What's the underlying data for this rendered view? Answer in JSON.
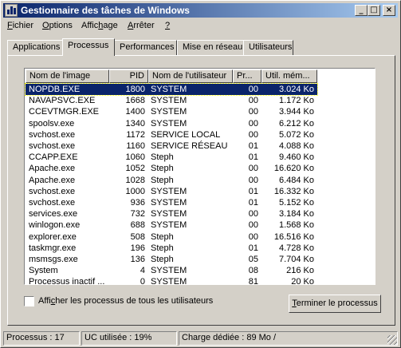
{
  "window": {
    "title": "Gestionnaire des tâches de Windows"
  },
  "titlebar_buttons": {
    "minimize": "_",
    "maximize": "□",
    "close": "×"
  },
  "menu": [
    {
      "accel": "F",
      "rest": "ichier"
    },
    {
      "accel": "O",
      "rest": "ptions"
    },
    {
      "pre": "Affic",
      "accel": "h",
      "rest": "age"
    },
    {
      "accel": "A",
      "rest": "rrêter"
    },
    {
      "accel": "?",
      "rest": ""
    }
  ],
  "tabs": [
    {
      "label": "Applications",
      "active": false
    },
    {
      "label": "Processus",
      "active": true
    },
    {
      "label": "Performances",
      "active": false
    },
    {
      "label": "Mise en réseau",
      "active": false
    },
    {
      "label": "Utilisateurs",
      "active": false
    }
  ],
  "columns": [
    "Nom de l'image",
    "PID",
    "Nom de l'utilisateur",
    "Pr...",
    "Util. mém..."
  ],
  "processes": [
    {
      "name": "NOPDB.EXE",
      "pid": "1800",
      "user": "SYSTEM",
      "cpu": "00",
      "mem": "3.024 Ko",
      "selected": true
    },
    {
      "name": "NAVAPSVC.EXE",
      "pid": "1668",
      "user": "SYSTEM",
      "cpu": "00",
      "mem": "1.172 Ko"
    },
    {
      "name": "CCEVTMGR.EXE",
      "pid": "1400",
      "user": "SYSTEM",
      "cpu": "00",
      "mem": "3.944 Ko"
    },
    {
      "name": "spoolsv.exe",
      "pid": "1340",
      "user": "SYSTEM",
      "cpu": "00",
      "mem": "6.212 Ko"
    },
    {
      "name": "svchost.exe",
      "pid": "1172",
      "user": "SERVICE LOCAL",
      "cpu": "00",
      "mem": "5.072 Ko"
    },
    {
      "name": "svchost.exe",
      "pid": "1160",
      "user": "SERVICE RÉSEAU",
      "cpu": "01",
      "mem": "4.088 Ko"
    },
    {
      "name": "CCAPP.EXE",
      "pid": "1060",
      "user": "Steph",
      "cpu": "01",
      "mem": "9.460 Ko"
    },
    {
      "name": "Apache.exe",
      "pid": "1052",
      "user": "Steph",
      "cpu": "00",
      "mem": "16.620 Ko"
    },
    {
      "name": "Apache.exe",
      "pid": "1028",
      "user": "Steph",
      "cpu": "00",
      "mem": "6.484 Ko"
    },
    {
      "name": "svchost.exe",
      "pid": "1000",
      "user": "SYSTEM",
      "cpu": "01",
      "mem": "16.332 Ko"
    },
    {
      "name": "svchost.exe",
      "pid": "936",
      "user": "SYSTEM",
      "cpu": "01",
      "mem": "5.152 Ko"
    },
    {
      "name": "services.exe",
      "pid": "732",
      "user": "SYSTEM",
      "cpu": "00",
      "mem": "3.184 Ko"
    },
    {
      "name": "winlogon.exe",
      "pid": "688",
      "user": "SYSTEM",
      "cpu": "00",
      "mem": "1.568 Ko"
    },
    {
      "name": "explorer.exe",
      "pid": "508",
      "user": "Steph",
      "cpu": "00",
      "mem": "16.516 Ko"
    },
    {
      "name": "taskmgr.exe",
      "pid": "196",
      "user": "Steph",
      "cpu": "01",
      "mem": "4.728 Ko"
    },
    {
      "name": "msmsgs.exe",
      "pid": "136",
      "user": "Steph",
      "cpu": "05",
      "mem": "7.704 Ko"
    },
    {
      "name": "System",
      "pid": "4",
      "user": "SYSTEM",
      "cpu": "08",
      "mem": "216 Ko"
    },
    {
      "name": "Processus inactif ...",
      "pid": "0",
      "user": "SYSTEM",
      "cpu": "81",
      "mem": "20 Ko"
    }
  ],
  "show_all": {
    "pre": "Affi",
    "accel": "c",
    "rest": "her les processus de tous les utilisateurs",
    "checked": false
  },
  "end_button": {
    "accel": "T",
    "rest": "erminer le processus"
  },
  "status": {
    "processes": "Processus : 17",
    "cpu": "UC utilisée : 19%",
    "commit": "Charge dédiée : 89 Mo /"
  }
}
